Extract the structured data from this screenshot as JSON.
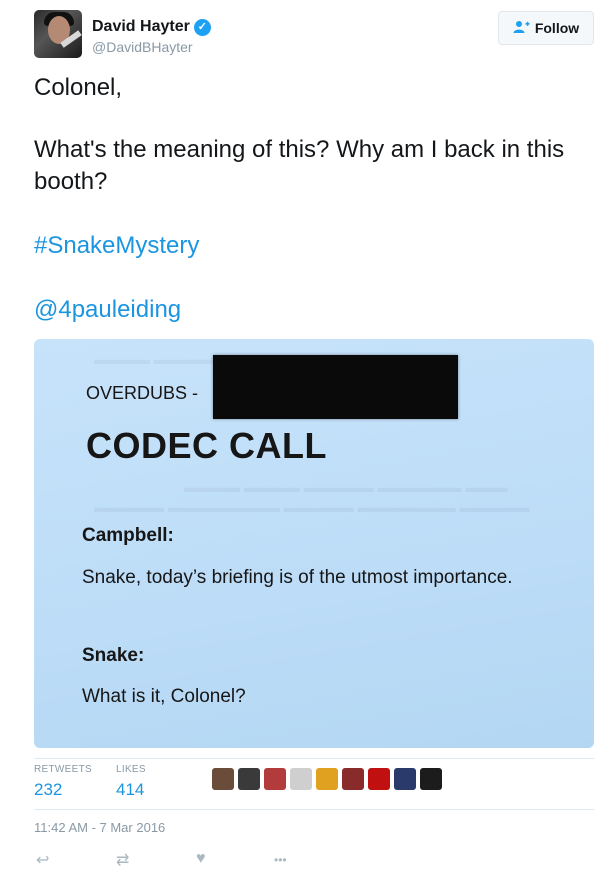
{
  "user": {
    "name": "David Hayter",
    "handle": "@DavidBHayter",
    "verified_glyph": "✓"
  },
  "follow": {
    "label": "Follow",
    "icon": "follow-person-icon"
  },
  "tweet": {
    "line1": "Colonel,",
    "line2": "What's the meaning of this?  Why am I back in this booth?",
    "hashtag": "#SnakeMystery",
    "mention": "@4pauleiding"
  },
  "image": {
    "overdubs": "OVERDUBS -",
    "title": "CODEC CALL",
    "speaker1": "Campbell:",
    "line1": "Snake, today’s briefing is of the utmost importance.",
    "speaker2": "Snake:",
    "line2": "What is it, Colonel?"
  },
  "stats": {
    "retweets_label": "RETWEETS",
    "retweets_count": "232",
    "likes_label": "LIKES",
    "likes_count": "414"
  },
  "likers": [
    "#6b4b3a",
    "#3a3a3a",
    "#b23b3b",
    "#cfcfcf",
    "#e0a020",
    "#8a2b2b",
    "#c01010",
    "#2a3a6a",
    "#1c1c1c"
  ],
  "timestamp": "11:42 AM - 7 Mar 2016",
  "actions": {
    "reply_glyph": "↩",
    "retweet_glyph": "⇄",
    "like_glyph": "♥",
    "more_glyph": "•••"
  },
  "colors": {
    "link": "#1b95e0",
    "verified": "#1da1f2",
    "muted": "#8899a6",
    "card_bg": "#bcdcf7"
  }
}
